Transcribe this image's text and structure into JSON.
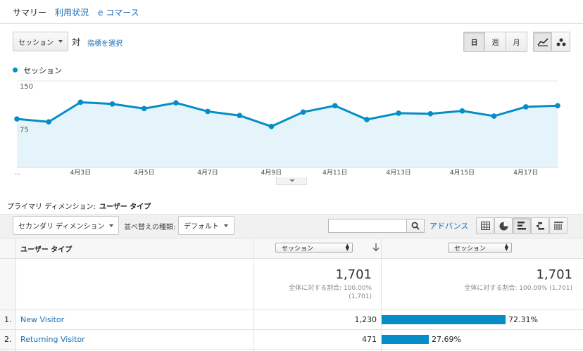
{
  "tabs": [
    {
      "label": "サマリー",
      "active": true
    },
    {
      "label": "利用状況",
      "active": false
    },
    {
      "label": "e コマース",
      "active": false
    }
  ],
  "metric_selector": {
    "value": "セッション"
  },
  "versus_label": "対",
  "select_metric_link": "指標を選択",
  "granularity": [
    {
      "label": "日",
      "selected": true
    },
    {
      "label": "週",
      "selected": false
    },
    {
      "label": "月",
      "selected": false
    }
  ],
  "chart_type_buttons": [
    "line-chart-icon",
    "motion-chart-icon"
  ],
  "legend_label": "セッション",
  "chart_data": {
    "type": "area",
    "series": [
      {
        "name": "セッション",
        "color": "#058dc7",
        "values": [
          84,
          79,
          113,
          110,
          102,
          112,
          97,
          90,
          71,
          96,
          107,
          83,
          94,
          93,
          98,
          89,
          105,
          107
        ]
      }
    ],
    "x": [
      "4月1日",
      "4月2日",
      "4月3日",
      "4月4日",
      "4月5日",
      "4月6日",
      "4月7日",
      "4月8日",
      "4月9日",
      "4月10日",
      "4月11日",
      "4月12日",
      "4月13日",
      "4月14日",
      "4月15日",
      "4月16日",
      "4月17日",
      "4月18日"
    ],
    "x_tick_labels": [
      "…",
      "4月3日",
      "4月5日",
      "4月7日",
      "4月9日",
      "4月11日",
      "4月13日",
      "4月15日",
      "4月17日"
    ],
    "y_tick_labels": [
      "150",
      "75"
    ],
    "ylim": [
      0,
      150
    ],
    "grid": true
  },
  "primary_dimension": {
    "label": "プライマリ ディメンション:",
    "value": "ユーザー タイプ"
  },
  "toolbar": {
    "secondary_dimension": "セカンダリ ディメンション",
    "sort_type_label": "並べ替えの種類:",
    "sort_type_value": "デフォルト",
    "search_placeholder": "",
    "advanced_link": "アドバンス",
    "view_buttons": [
      "table-view-icon",
      "pie-view-icon",
      "performance-view-icon",
      "comparison-view-icon",
      "pivot-view-icon"
    ]
  },
  "table": {
    "dimension_header": "ユーザー タイプ",
    "metric_header_1": "セッション",
    "metric_header_2": "セッション",
    "totals": {
      "value_1": "1,701",
      "pct_1": "全体に対する割合: 100.00%",
      "total_1": "(1,701)",
      "value_2": "1,701",
      "pct_2": "全体に対する割合: 100.00% (1,701)"
    },
    "rows": [
      {
        "index": "1.",
        "name": "New Visitor",
        "sessions": "1,230",
        "percent": "72.31%",
        "fraction": 0.7231
      },
      {
        "index": "2.",
        "name": "Returning Visitor",
        "sessions": "471",
        "percent": "27.69%",
        "fraction": 0.2769
      }
    ]
  }
}
